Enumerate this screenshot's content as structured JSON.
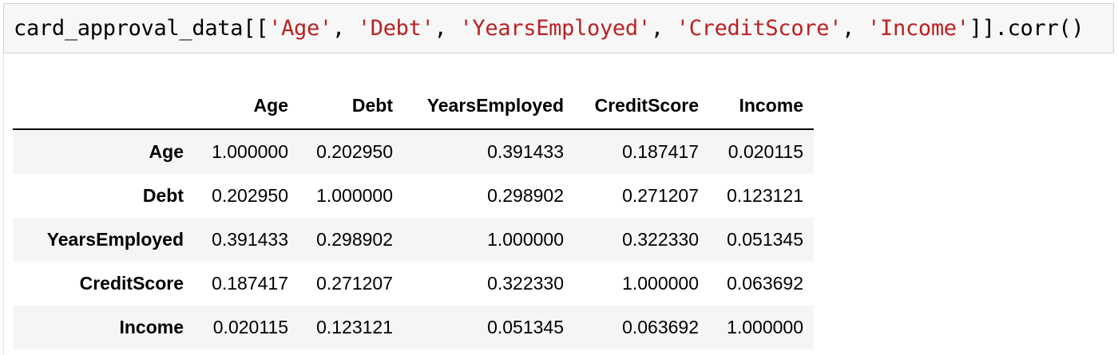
{
  "code_cell": {
    "prefix": "card_approval_data[[",
    "strings": [
      "'Age'",
      "'Debt'",
      "'YearsEmployed'",
      "'CreditScore'",
      "'Income'"
    ],
    "separator": ", ",
    "suffix": "]].corr()",
    "string_color": "#ba2121"
  },
  "table": {
    "index_header": "",
    "columns": [
      "Age",
      "Debt",
      "YearsEmployed",
      "CreditScore",
      "Income"
    ],
    "rows": [
      {
        "label": "Age",
        "values": [
          "1.000000",
          "0.202950",
          "0.391433",
          "0.187417",
          "0.020115"
        ]
      },
      {
        "label": "Debt",
        "values": [
          "0.202950",
          "1.000000",
          "0.298902",
          "0.271207",
          "0.123121"
        ]
      },
      {
        "label": "YearsEmployed",
        "values": [
          "0.391433",
          "0.298902",
          "1.000000",
          "0.322330",
          "0.051345"
        ]
      },
      {
        "label": "CreditScore",
        "values": [
          "0.187417",
          "0.271207",
          "0.322330",
          "1.000000",
          "0.063692"
        ]
      },
      {
        "label": "Income",
        "values": [
          "0.020115",
          "0.123121",
          "0.051345",
          "0.063692",
          "1.000000"
        ]
      }
    ],
    "stripe_color": "#f5f5f5"
  }
}
